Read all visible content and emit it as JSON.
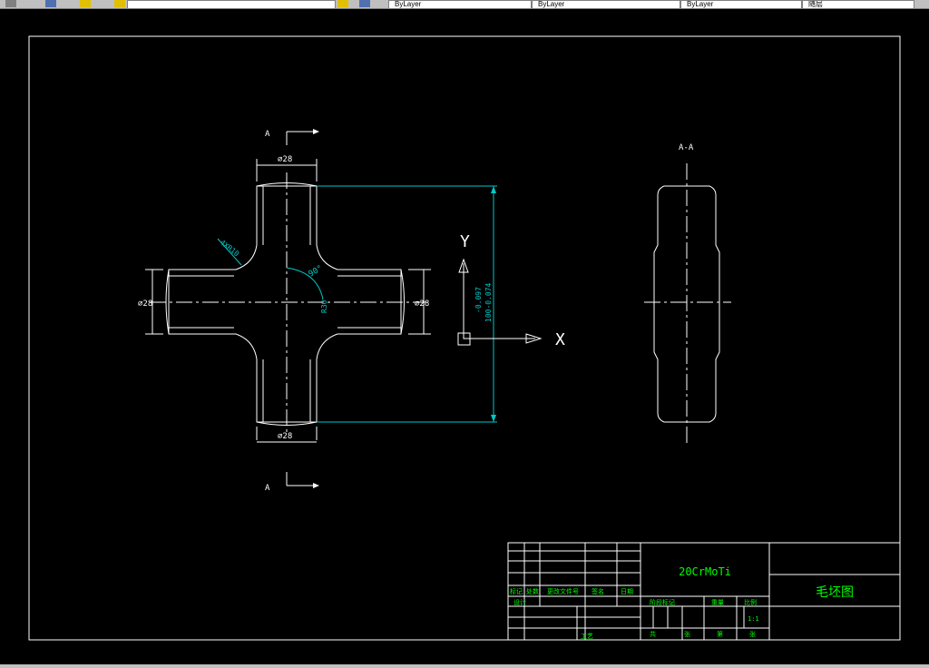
{
  "toolbar": {
    "layer_1": "ByLayer",
    "layer_2": "ByLayer",
    "layer_3": "ByLayer",
    "style": "随层"
  },
  "drawing": {
    "section_label_top": "A",
    "section_label_bottom": "A",
    "section_view_label": "A-A",
    "dim_top": "⌀28",
    "dim_bottom": "⌀28",
    "dim_left": "⌀28",
    "dim_right": "⌀28",
    "dim_radius": "R25",
    "dim_angle": "90°",
    "dim_angle_r": "R30",
    "dim_overall_tol": "-0.097",
    "dim_overall": "100-0.074",
    "chamfer_note": "4XR10",
    "axis_y": "Y",
    "axis_x": "X"
  },
  "title_block": {
    "material": "20CrMoTi",
    "part_name": "毛坯图",
    "labels": {
      "mark": "标记",
      "count": "处数",
      "file_no": "更改文件号",
      "sign": "签名",
      "date": "日期",
      "design": "设计",
      "process": "工艺",
      "stage_mark": "阶段标记",
      "weight": "重量",
      "scale": "比例",
      "scale_value": "1:1",
      "total": "共",
      "sheet": "张",
      "page": "第",
      "sheet2": "张"
    }
  }
}
